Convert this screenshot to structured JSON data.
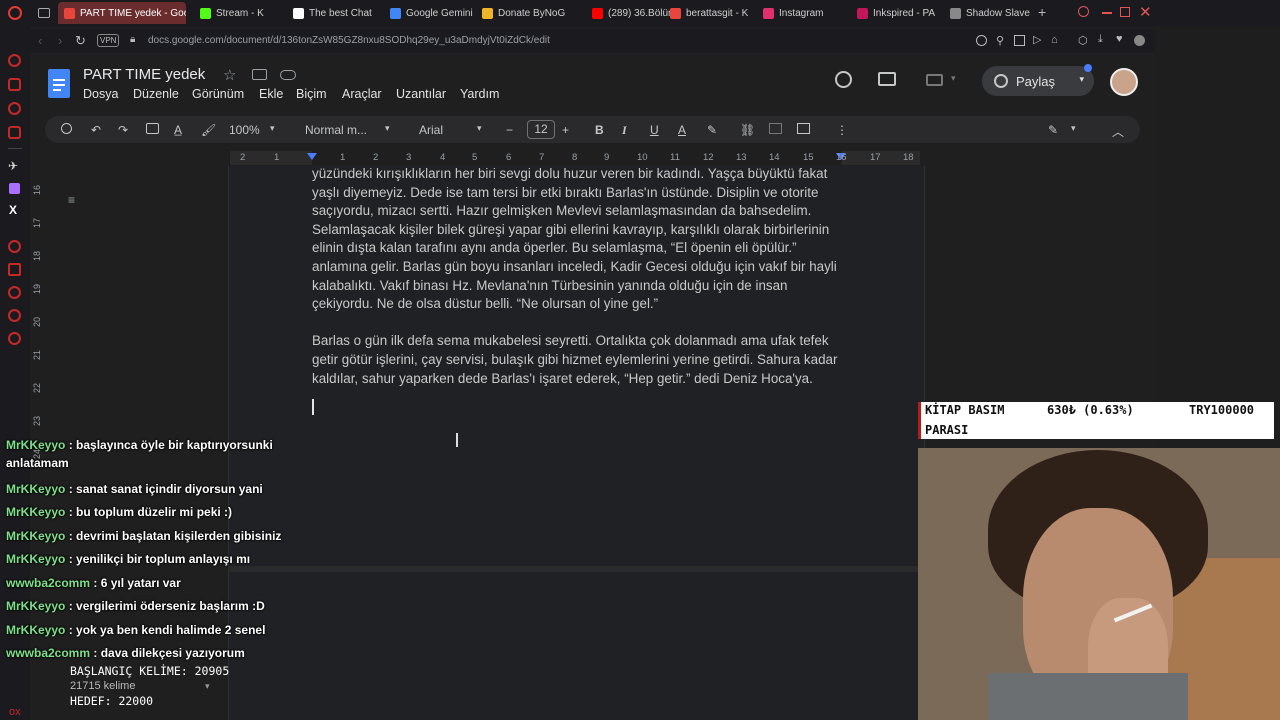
{
  "tabs": [
    {
      "label": "PART TIME yedek - Goog",
      "active": true
    },
    {
      "label": "Stream - K"
    },
    {
      "label": "The best Chat"
    },
    {
      "label": "Google Gemini"
    },
    {
      "label": "Donate ByNoG"
    },
    {
      "label": "(289) 36.Bölüm"
    },
    {
      "label": "berattasgit - K"
    },
    {
      "label": "Instagram"
    },
    {
      "label": "Inkspired - PA"
    },
    {
      "label": "Shadow Slave"
    }
  ],
  "address": {
    "badge": "VPN",
    "url": "docs.google.com/document/d/136tonZsW85GZ8nxu8SODhq29ey_u3aDmdyjVt0iZdCk/edit"
  },
  "doc": {
    "title": "PART TIME  yedek",
    "menu": [
      "Dosya",
      "Düzenle",
      "Görünüm",
      "Ekle",
      "Biçim",
      "Araçlar",
      "Uzantılar",
      "Yardım"
    ],
    "share_label": "Paylaş",
    "zoom": "100%",
    "style": "Normal m...",
    "font": "Arial",
    "font_size": "12",
    "ruler": [
      "2",
      "1",
      "1",
      "2",
      "3",
      "4",
      "5",
      "6",
      "7",
      "8",
      "9",
      "10",
      "11",
      "12",
      "13",
      "14",
      "15",
      "16",
      "17",
      "18"
    ],
    "side_ruler": [
      "16",
      "17",
      "18",
      "19",
      "20",
      "21",
      "22",
      "23",
      "24"
    ],
    "paragraphs": [
      "yüzündeki kırışıklıkların her biri sevgi dolu huzur veren bir kadındı. Yaşça büyüktü fakat yaşlı diyemeyiz. Dede ise tam tersi bir etki bıraktı Barlas'ın üstünde. Disiplin ve otorite saçıyordu, mizacı sertti. Hazır gelmişken Mevlevi selamlaşmasından da bahsedelim. Selamlaşacak kişiler bilek güreşi yapar gibi ellerini kavrayıp, karşılıklı olarak birbirlerinin elinin dışta kalan tarafını aynı anda öperler. Bu selamlaşma, “El öpenin eli öpülür.” anlamına gelir. Barlas gün boyu insanları inceledi, Kadir Gecesi olduğu için vakıf bir hayli kalabalıktı. Vakıf binası Hz. Mevlana'nın Türbesinin yanında olduğu için de insan çekiyordu. Ne de olsa düstur belli. “Ne olursan ol yine gel.”",
      "Barlas o gün ilk defa sema mukabelesi seyretti. Ortalıkta çok dolanmadı ama ufak tefek getir götür işlerini, çay servisi, bulaşık gibi hizmet eylemlerini yerine getirdi. Sahura kadar kaldılar, sahur yaparken dede Barlas'ı işaret ederek, “Hep getir.” dedi Deniz Hoca'ya."
    ],
    "word_count": "21715 kelime"
  },
  "ticker": {
    "name": "KİTAP BASIM",
    "change": "630₺ (0.63%)",
    "goal": "TRY100000",
    "name2": "PARASI"
  },
  "chat": [
    {
      "user": "MrKKeyyo",
      "text": "başlayınca öyle bir kaptırıyorsunki anlatamam",
      "color": "#7ee08a"
    },
    {
      "user": "MrKKeyyo",
      "text": "sanat sanat içindir diyorsun yani",
      "color": "#7ee08a"
    },
    {
      "user": "MrKKeyyo",
      "text": "bu toplum düzelir mi peki :)",
      "color": "#7ee08a"
    },
    {
      "user": "MrKKeyyo",
      "text": "devrimi başlatan kişilerden gibisiniz",
      "color": "#7ee08a"
    },
    {
      "user": "MrKKeyyo",
      "text": "yenilikçi bir toplum anlayışı mı",
      "color": "#7ee08a"
    },
    {
      "user": "wwwba2comm",
      "text": "6 yıl yatarı var",
      "color": "#7ee08a"
    },
    {
      "user": "MrKKeyyo",
      "text": "vergilerimi öderseniz başlarım :D",
      "color": "#7ee08a"
    },
    {
      "user": "MrKKeyyo",
      "text": "yok ya ben kendi halimde 2 senel",
      "color": "#7ee08a"
    },
    {
      "user": "wwwba2comm",
      "text": "dava dilekçesi yazıyorum",
      "color": "#7ee08a"
    }
  ],
  "counter": {
    "start": "BAŞLANGIÇ KELİME: 20905",
    "goal": "HEDEF: 22000"
  }
}
